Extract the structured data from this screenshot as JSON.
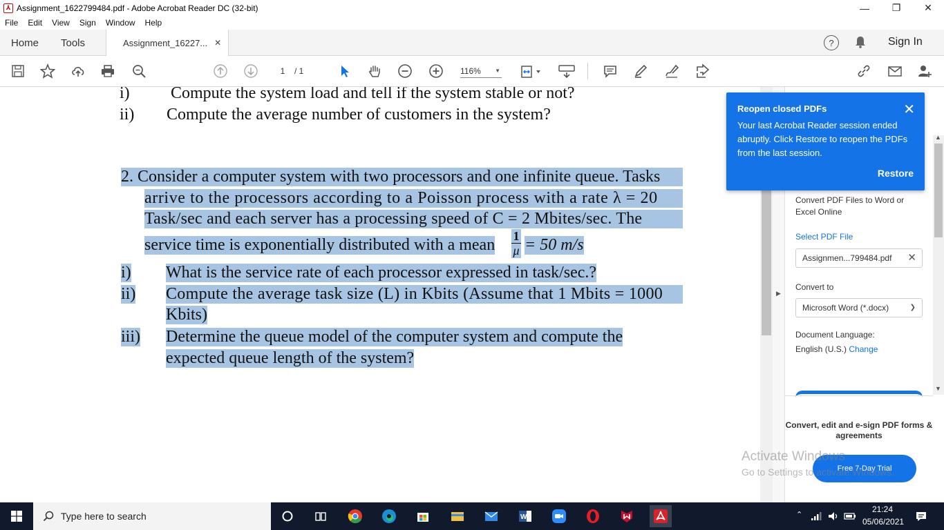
{
  "window": {
    "title": "Assignment_1622799484.pdf - Adobe Acrobat Reader DC (32-bit)",
    "minimize": "—",
    "maximize": "❐",
    "close": "✕"
  },
  "menu": [
    "File",
    "Edit",
    "View",
    "Sign",
    "Window",
    "Help"
  ],
  "tabs": {
    "home": "Home",
    "tools": "Tools",
    "doc": "Assignment_16227...",
    "doc_close": "✕",
    "help": "?",
    "signin": "Sign In"
  },
  "toolbar": {
    "page_current": "1",
    "page_total": "/ 1",
    "zoom": "116%"
  },
  "document": {
    "q1_i_num": "i)",
    "q1_i_text": "Compute the system load and tell if the system stable or not?",
    "q1_ii_num": "ii)",
    "q1_ii_text": "Compute the average number of customers in the system?",
    "q2_line1": "2.  Consider a computer system with two processors and one infinite queue. Tasks",
    "q2_line2": "arrive to the processors according to a Poisson process with a rate λ = 20",
    "q2_line3": "Task/sec and each server has a processing speed of C = 2 Mbites/sec. The",
    "q2_line4": "service time is exponentially distributed with a mean",
    "frac_num": "1",
    "frac_den": "μ",
    "q2_line4_tail": "= 50 m/s",
    "q2_i_num": "i)",
    "q2_i_text": "What is the service rate of each processor expressed in task/sec.?",
    "q2_ii_num": "ii)",
    "q2_ii_text": "Compute the average task size (L) in Kbits (Assume that 1 Mbits = 1000",
    "q2_ii_text2": "Kbits)",
    "q2_iii_num": "iii)",
    "q2_iii_text": "Determine the queue model of the computer system and compute the",
    "q2_iii_text2": "expected queue length of the system?"
  },
  "toast": {
    "title": "Reopen closed PDFs",
    "body": "Your last Acrobat Reader session ended abruptly. Click Restore to reopen the PDFs from the last session.",
    "restore": "Restore"
  },
  "right_panel": {
    "convert_desc": "Convert PDF Files to Word or Excel Online",
    "select_file": "Select PDF File",
    "file_name": "Assignmen...799484.pdf",
    "convert_to": "Convert to",
    "format": "Microsoft Word (*.docx)",
    "doc_lang_label": "Document Language:",
    "doc_lang_value": "English (U.S.)",
    "change": "Change",
    "cta": "Convert, edit and e-sign PDF forms & agreements",
    "trial": "Free 7-Day Trial"
  },
  "watermark": {
    "line1": "Activate Windows",
    "line2": "Go to Settings to activate Windows."
  },
  "taskbar": {
    "search_placeholder": "Type here to search",
    "time": "21:24",
    "date": "05/06/2021"
  },
  "colors": {
    "accent": "#1473e6",
    "highlight": "#a7c5e3",
    "taskbar": "#101a2c"
  }
}
